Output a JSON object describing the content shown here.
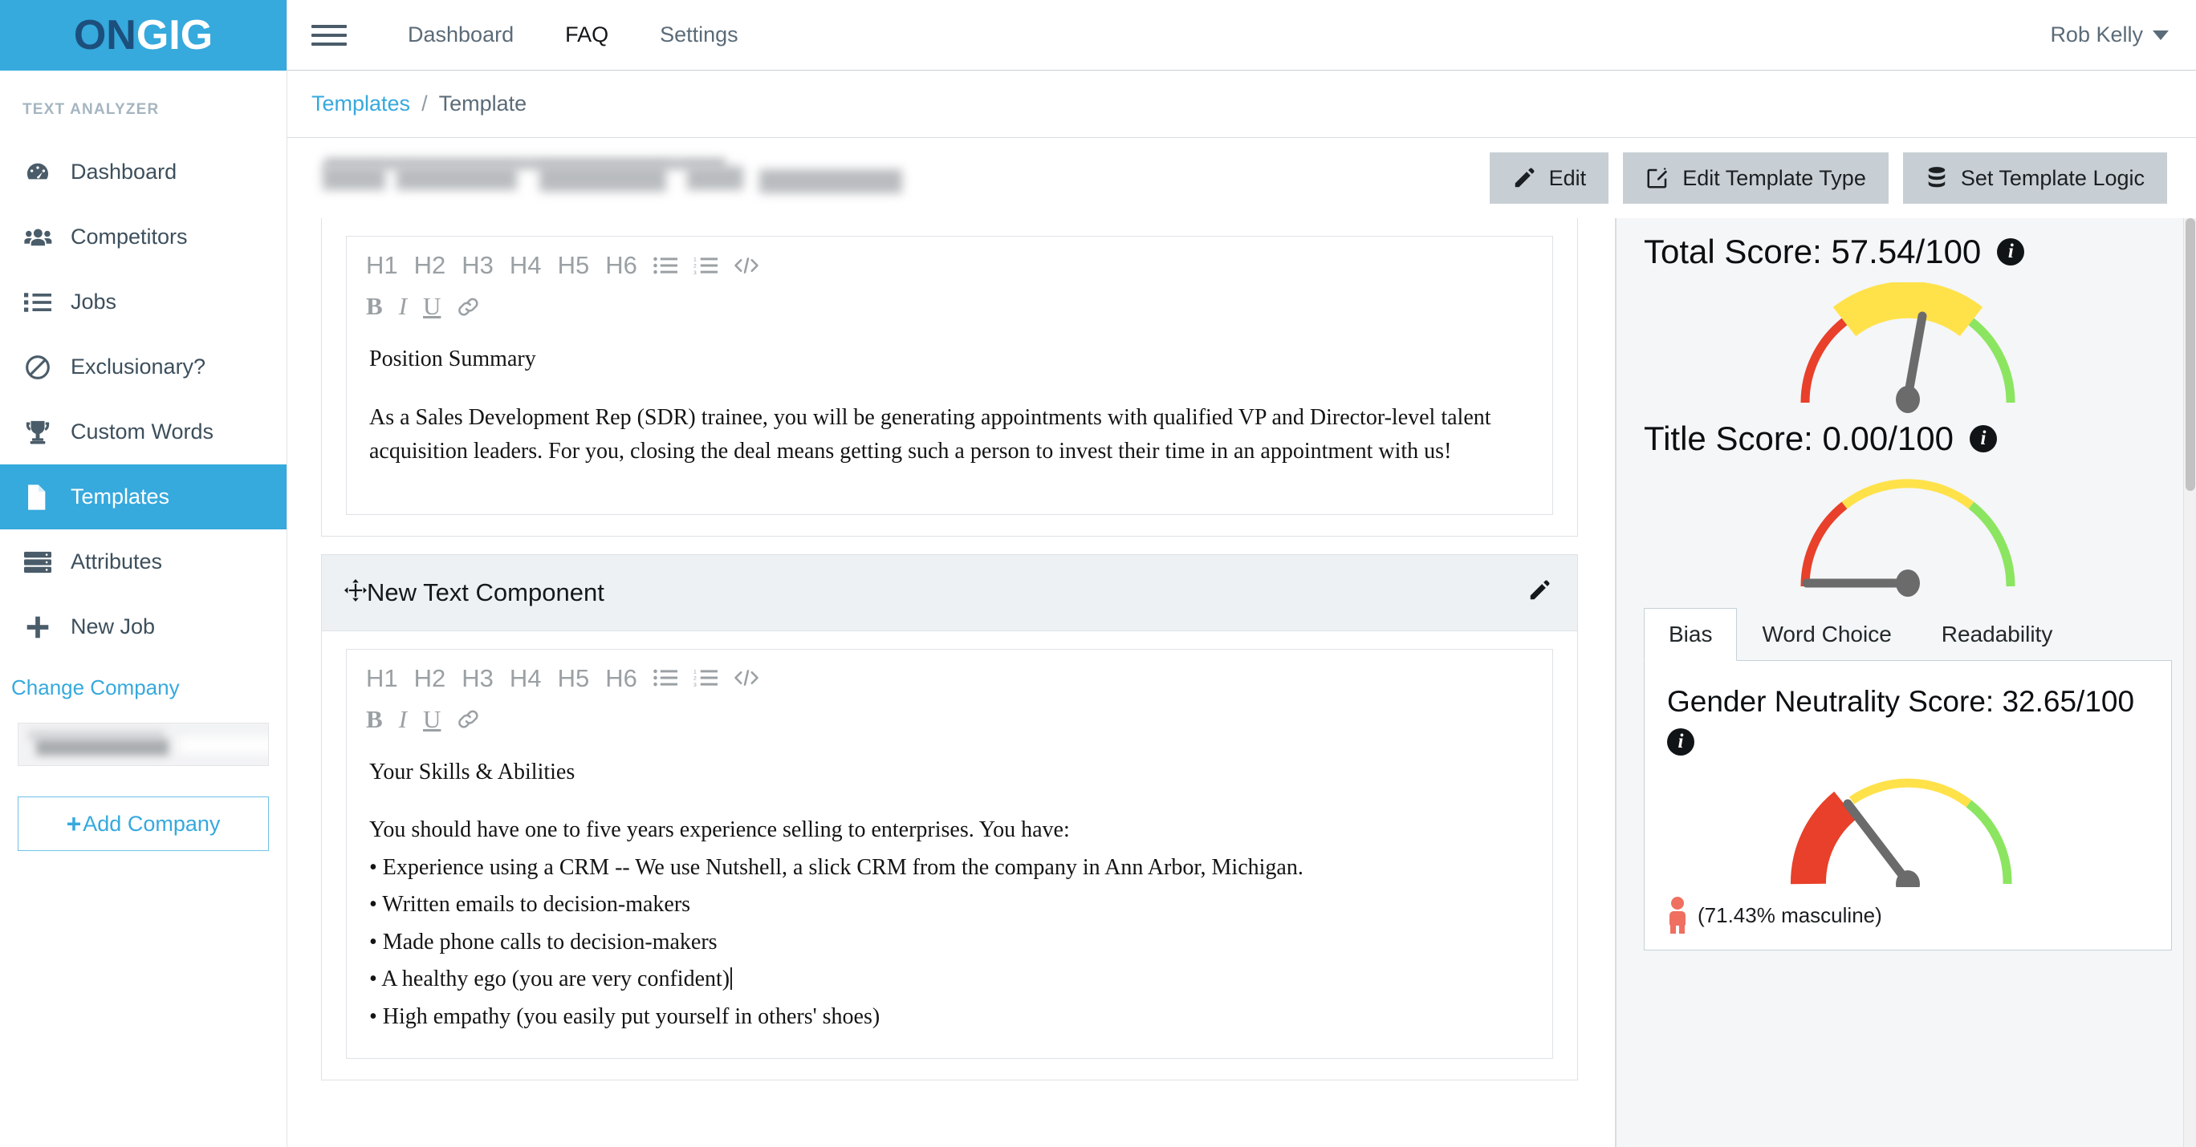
{
  "brand": {
    "logo_on": "ON",
    "logo_gig": "GIG",
    "accent": "#36a9dd",
    "logo_dark": "#1c4f7c"
  },
  "sidebar": {
    "section_label": "TEXT ANALYZER",
    "items": [
      {
        "label": "Dashboard",
        "icon": "speedometer-icon",
        "active": false
      },
      {
        "label": "Competitors",
        "icon": "users-icon",
        "active": false
      },
      {
        "label": "Jobs",
        "icon": "list-icon",
        "active": false
      },
      {
        "label": "Exclusionary?",
        "icon": "ban-icon",
        "active": false
      },
      {
        "label": "Custom Words",
        "icon": "trophy-icon",
        "active": false
      },
      {
        "label": "Templates",
        "icon": "file-icon",
        "active": true
      },
      {
        "label": "Attributes",
        "icon": "server-icon",
        "active": false
      },
      {
        "label": "New Job",
        "icon": "plus-icon",
        "active": false
      }
    ],
    "change_company": "Change Company",
    "company_selected": "",
    "add_company": "Add Company",
    "add_company_plus": "+"
  },
  "topbar": {
    "menu_icon": "hamburger-icon",
    "nav": [
      {
        "label": "Dashboard",
        "active": false
      },
      {
        "label": "FAQ",
        "active": true
      },
      {
        "label": "Settings",
        "active": false
      }
    ],
    "user": "Rob Kelly"
  },
  "breadcrumb": {
    "parent": "Templates",
    "separator": "/",
    "current": "Template"
  },
  "page_head": {
    "title_redacted": true,
    "actions": [
      {
        "label": "Edit",
        "icon": "pencil-icon"
      },
      {
        "label": "Edit Template Type",
        "icon": "pen-square-icon"
      },
      {
        "label": "Set Template Logic",
        "icon": "database-icon"
      }
    ]
  },
  "editor": {
    "toolbar_row1": [
      "H1",
      "H2",
      "H3",
      "H4",
      "H5",
      "H6"
    ],
    "toolbar_icons1": [
      "bullet-list-icon",
      "numbered-list-icon",
      "code-icon"
    ],
    "toolbar_row2": [
      "B",
      "I",
      "U"
    ],
    "toolbar_icons2": [
      "link-icon"
    ],
    "components": [
      {
        "header": null,
        "heading": "Position Summary",
        "paragraph": "As a Sales Development Rep (SDR) trainee, you will be generating appointments with qualified VP and Director-level talent acquisition leaders. For you, closing the deal means getting such a person to invest their time in an appointment with us!",
        "bullets": []
      },
      {
        "header": "New Text Component",
        "header_drag_icon": "move-icon",
        "header_edit_icon": "pencil-icon",
        "heading": "Your Skills & Abilities",
        "paragraph": "You should have one to five years experience selling to enterprises. You have:",
        "bullets": [
          "• Experience using a CRM -- We use Nutshell, a slick CRM from the company in Ann Arbor, Michigan.",
          "• Written emails to decision-makers",
          "• Made phone calls to decision-makers",
          "• A healthy ego (you are very confident)",
          "• High empathy (you easily put yourself in others' shoes)"
        ],
        "caret_after_bullet_index": 3
      }
    ]
  },
  "scores": {
    "total": {
      "label": "Total Score: 57.54/100",
      "value": 57.54,
      "max": 100,
      "info_icon": "info-icon"
    },
    "title": {
      "label": "Title Score: 0.00/100",
      "value": 0.0,
      "max": 100,
      "info_icon": "info-icon"
    },
    "tabs": [
      {
        "label": "Bias",
        "active": true
      },
      {
        "label": "Word Choice",
        "active": false
      },
      {
        "label": "Readability",
        "active": false
      }
    ],
    "gender": {
      "label": "Gender Neutrality Score: 32.65/100",
      "value": 32.65,
      "max": 100,
      "info_icon": "info-icon",
      "masculine_label": "(71.43% masculine)",
      "masculine_pct": 71.43,
      "person_icon": "person-icon",
      "person_color": "#ef6f61"
    },
    "gauge_colors": {
      "red": "#e8402a",
      "yellow": "#ffe24a",
      "green": "#8ce560",
      "needle": "#6b6b6b"
    }
  }
}
